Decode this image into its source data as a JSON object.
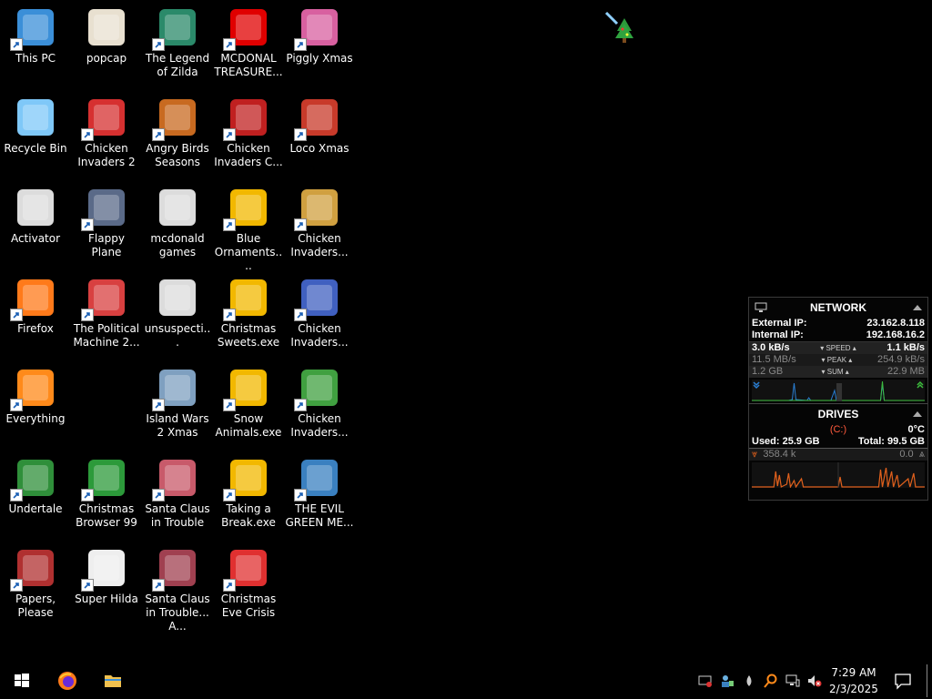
{
  "desktop": {
    "icons": [
      {
        "label": "This PC"
      },
      {
        "label": "Recycle Bin"
      },
      {
        "label": "Activator"
      },
      {
        "label": "Firefox"
      },
      {
        "label": "Everything"
      },
      {
        "label": "Undertale"
      },
      {
        "label": "Papers, Please"
      },
      {
        "label": "popcap"
      },
      {
        "label": "Chicken Invaders 2"
      },
      {
        "label": "Flappy Plane"
      },
      {
        "label": "The Political Machine 2..."
      },
      {
        "label": "Christmas Browser 99"
      },
      {
        "label": "Super Hilda"
      },
      {
        "label": "The Legend of Zilda"
      },
      {
        "label": "Angry Birds Seasons"
      },
      {
        "label": "mcdonald games"
      },
      {
        "label": "unsuspecti..."
      },
      {
        "label": "Island Wars 2 Xmas"
      },
      {
        "label": "Santa Claus in Trouble"
      },
      {
        "label": "Santa Claus in Trouble... A..."
      },
      {
        "label": "MCDONAL TREASURE..."
      },
      {
        "label": "Chicken Invaders C..."
      },
      {
        "label": "Blue Ornaments...."
      },
      {
        "label": "Christmas Sweets.exe"
      },
      {
        "label": "Snow Animals.exe"
      },
      {
        "label": "Taking a Break.exe"
      },
      {
        "label": "Christmas Eve Crisis"
      },
      {
        "label": "Piggly Xmas"
      },
      {
        "label": "Loco Xmas"
      },
      {
        "label": "Chicken Invaders..."
      },
      {
        "label": "Chicken Invaders..."
      },
      {
        "label": "Chicken Invaders..."
      },
      {
        "label": "THE EVIL GREEN ME..."
      }
    ]
  },
  "widget": {
    "network": {
      "title": "NETWORK",
      "external_ip_label": "External IP:",
      "external_ip": "23.162.8.118",
      "internal_ip_label": "Internal IP:",
      "internal_ip": "192.168.16.2",
      "speed_down": "3.0 kB/s",
      "speed_label": "SPEED",
      "speed_up": "1.1 kB/s",
      "peak_down": "11.5 MB/s",
      "peak_label": "PEAK",
      "peak_up": "254.9 kB/s",
      "sum_down": "1.2 GB",
      "sum_label": "SUM",
      "sum_up": "22.9 MB"
    },
    "drives": {
      "title": "DRIVES",
      "drive": "(C:)",
      "temp": "0°C",
      "used": "Used: 25.9 GB",
      "total": "Total: 99.5 GB",
      "read": "358.4 k",
      "write": "0.0"
    }
  },
  "taskbar": {
    "time": "7:29 AM",
    "date": "2/3/2025"
  },
  "colors": {
    "network_graph": "#2a7fd4",
    "drives_graph": "#e0601c",
    "drive_letter": "#ff5a3c",
    "upload_graph": "#3dbd3d"
  }
}
